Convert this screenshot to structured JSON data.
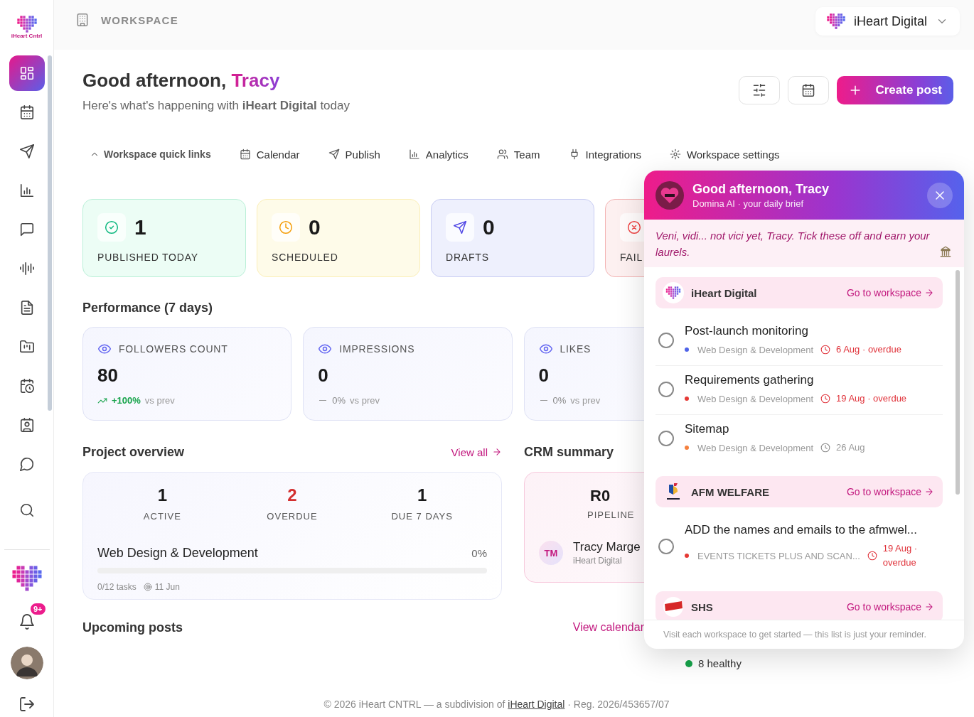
{
  "brand": {
    "name": "iHeart Cntrl"
  },
  "sidebar": {
    "items": [
      {
        "kind": "grid",
        "selected": true
      },
      {
        "kind": "calendar",
        "selected": false
      },
      {
        "kind": "send",
        "selected": false
      },
      {
        "kind": "chart",
        "selected": false
      },
      {
        "kind": "message-square",
        "selected": false
      },
      {
        "kind": "audio",
        "selected": false
      },
      {
        "kind": "file",
        "selected": false
      },
      {
        "kind": "folder-chart",
        "selected": false
      },
      {
        "kind": "calendar-clock",
        "selected": false
      },
      {
        "kind": "contact",
        "selected": false
      },
      {
        "kind": "message-circle",
        "selected": false
      },
      {
        "kind": "search",
        "selected": false
      }
    ],
    "notifications_badge": "9+"
  },
  "topbar": {
    "section": "WORKSPACE",
    "workspace": "iHeart Digital"
  },
  "header": {
    "greeting": "Good afternoon,",
    "name": "Tracy",
    "subtitle": "Here's what's happening with **iHeart Digital** today"
  },
  "actions": {
    "create": "Create post"
  },
  "quick_links": {
    "toggle": {
      "label": "Workspace quick links",
      "expanded": true
    },
    "items": [
      {
        "kind": "calendar",
        "label": "Calendar"
      },
      {
        "kind": "send",
        "label": "Publish"
      },
      {
        "kind": "chart",
        "label": "Analytics"
      },
      {
        "kind": "users",
        "label": "Team"
      },
      {
        "kind": "plug",
        "label": "Integrations"
      },
      {
        "kind": "settings",
        "label": "Workspace settings"
      }
    ]
  },
  "stats": [
    {
      "kind": "published",
      "value": "1",
      "label": "PUBLISHED TODAY"
    },
    {
      "kind": "scheduled",
      "value": "0",
      "label": "SCHEDULED"
    },
    {
      "kind": "drafts",
      "value": "0",
      "label": "DRAFTS"
    },
    {
      "kind": "failed",
      "label": "FAIL"
    }
  ],
  "performance": {
    "title": "Performance (7 days)",
    "cards": [
      {
        "label": "FOLLOWERS COUNT",
        "value": "80",
        "kind": "up",
        "change": "+100%",
        "note": "vs prev"
      },
      {
        "label": "IMPRESSIONS",
        "value": "0",
        "kind": "flat",
        "change": "0%",
        "note": "vs prev"
      },
      {
        "label": "LIKES",
        "value": "0",
        "kind": "flat",
        "change": "0%",
        "note": "vs prev"
      }
    ]
  },
  "projects": {
    "title": "Project overview",
    "link": "View all",
    "stats": [
      {
        "value": "1",
        "label": "ACTIVE",
        "alert": false
      },
      {
        "value": "2",
        "label": "OVERDUE",
        "alert": true
      },
      {
        "value": "1",
        "label": "DUE 7 DAYS",
        "alert": false
      }
    ],
    "items": [
      {
        "name": "Web Design & Development",
        "percent": "0%",
        "level": 0,
        "tasks": "0/12 tasks",
        "date": "11 Jun"
      }
    ]
  },
  "crm": {
    "title": "CRM summary",
    "value": "R0",
    "label": "PIPELINE",
    "contact": {
      "initials": "TM",
      "name": "Tracy Marge",
      "company": "iHeart Digital"
    },
    "health": "8 healthy"
  },
  "upcoming": {
    "title": "Upcoming posts",
    "link": "View calendar"
  },
  "footer": {
    "before": "© 2026 iHeart CNTRL — a subdivision of",
    "link": "iHeart Digital",
    "after": "· Reg. 2026/453657/07"
  },
  "brief": {
    "title": "Good afternoon, Tracy",
    "subtitle": "Domina AI · your daily brief",
    "quote": "Veni, vidi... not vici yet, Tracy. Tick these off and earn your laurels.",
    "groups": [
      {
        "name": "iHeart Digital",
        "kind": "heart",
        "link": "Go to workspace",
        "tasks": [
          {
            "title": "Post-launch monitoring",
            "checked": false,
            "project": "Web Design & Development",
            "color": "#4f63e8",
            "due": "6 Aug · overdue",
            "overdue": true
          },
          {
            "title": "Requirements gathering",
            "checked": false,
            "project": "Web Design & Development",
            "color": "#e53935",
            "due": "19 Aug · overdue",
            "overdue": true
          },
          {
            "title": "Sitemap",
            "checked": false,
            "project": "Web Design & Development",
            "color": "#f5803e",
            "due": "26 Aug",
            "overdue": false
          }
        ]
      },
      {
        "name": "AFM WELFARE",
        "kind": "crest",
        "link": "Go to workspace",
        "tasks": [
          {
            "title": "ADD the names and emails to the afmwel...",
            "checked": false,
            "project": "EVENTS TICKETS PLUS AND SCAN...",
            "color": "#e53935",
            "due": "19 Aug · overdue",
            "overdue": true
          }
        ]
      },
      {
        "name": "SHS",
        "kind": "badge",
        "link": "Go to workspace"
      }
    ],
    "note": "Visit each workspace to get started — this list is just your reminder."
  }
}
